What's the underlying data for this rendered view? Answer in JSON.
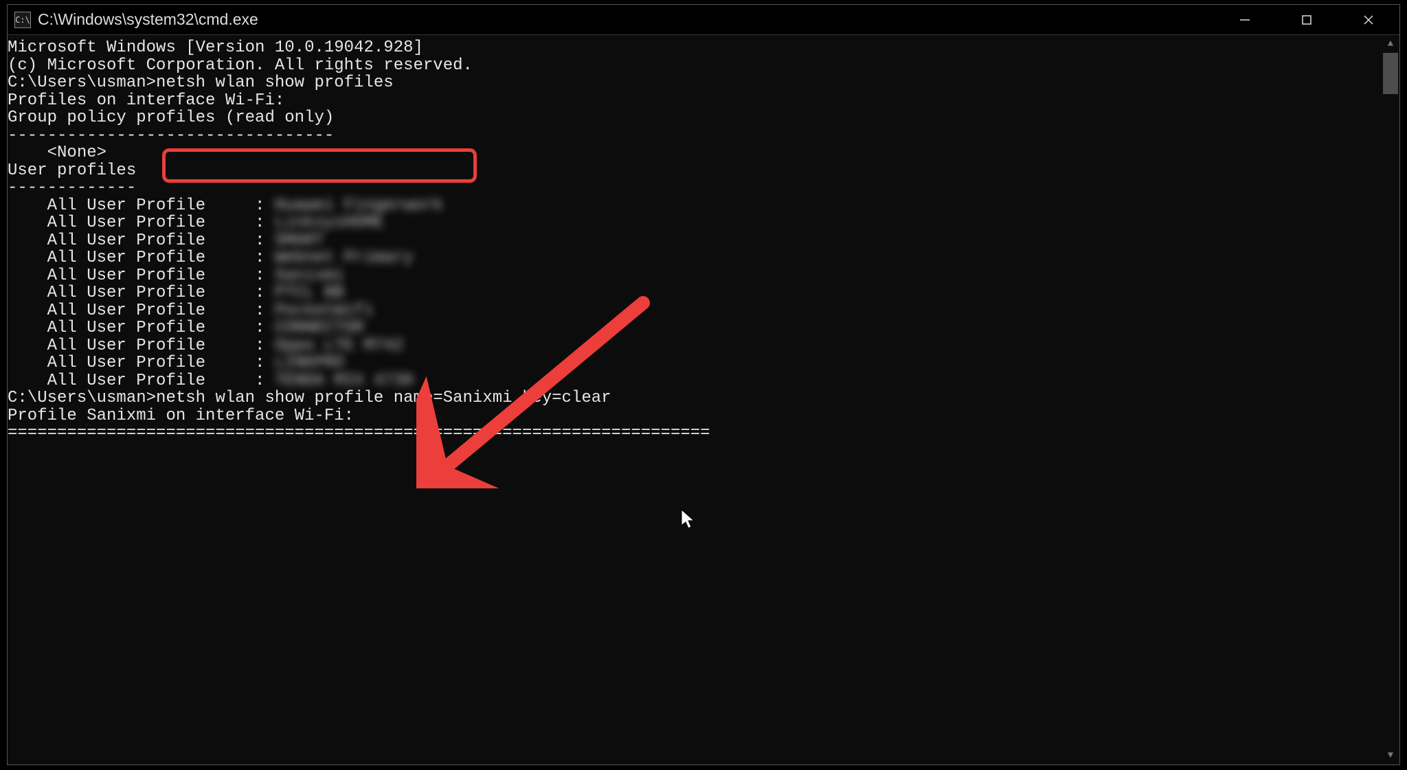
{
  "titlebar": {
    "icon_text": "C:\\",
    "title": "C:\\Windows\\system32\\cmd.exe"
  },
  "window_controls": {
    "minimize": "—",
    "maximize": "▢",
    "close": "✕"
  },
  "scrollbar": {
    "up": "▲",
    "down": "▼"
  },
  "terminal": {
    "header1": "Microsoft Windows [Version 10.0.19042.928]",
    "header2": "(c) Microsoft Corporation. All rights reserved.",
    "blank": "",
    "prompt1_path": "C:\\Users\\usman>",
    "prompt1_cmd": "netsh wlan show profiles",
    "pi_header": "Profiles on interface Wi-Fi:",
    "gp_header": "Group policy profiles (read only)",
    "gp_divider": "---------------------------------",
    "gp_none": "    <None>",
    "up_header": "User profiles",
    "up_divider": "-------------",
    "profile_prefix": "    All User Profile     : ",
    "profiles_blurred": [
      "Huawei Fingerwork",
      "LinksysHOME",
      "SMART",
      "Webnet Primary",
      "Sanixmi",
      "PTCL BB",
      "PocketWifi",
      "CONNECTOR",
      "Oppo LTE M742",
      "LINKPRO",
      "TENDA MIX 4730"
    ],
    "prompt2_path": "C:\\Users\\usman>",
    "prompt2_cmd": "netsh wlan show profile name=Sanixmi key=clear",
    "profile_info_header": "Profile Sanixmi on interface Wi-Fi:",
    "long_divider": "======================================================================="
  }
}
